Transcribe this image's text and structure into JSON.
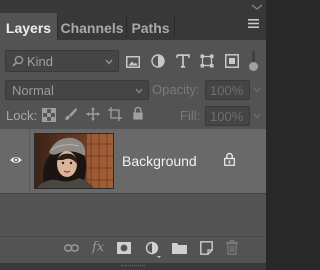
{
  "tabs": [
    {
      "label": "Layers",
      "active": true
    },
    {
      "label": "Channels",
      "active": false
    },
    {
      "label": "Paths",
      "active": false
    }
  ],
  "filter": {
    "kind_label": "Kind",
    "icons": [
      "image-filter-icon",
      "adjustment-filter-icon",
      "type-filter-icon",
      "shape-filter-icon",
      "smart-object-filter-icon",
      "filter-toggle-icon"
    ]
  },
  "blend": {
    "mode": "Normal",
    "opacity_label": "Opacity:",
    "opacity_value": "100%"
  },
  "lock": {
    "label": "Lock:",
    "fill_label": "Fill:",
    "fill_value": "100%"
  },
  "layers": [
    {
      "name": "Background",
      "visible": true,
      "locked": true
    }
  ],
  "footer_icons": [
    "link-layers-icon",
    "fx-icon",
    "add-mask-icon",
    "adjustment-layer-icon",
    "group-folder-icon",
    "new-layer-icon",
    "trash-icon"
  ],
  "colors": {
    "panel_bg": "#535353",
    "tabbar_bg": "#383838",
    "selected_layer_bg": "#696969"
  }
}
